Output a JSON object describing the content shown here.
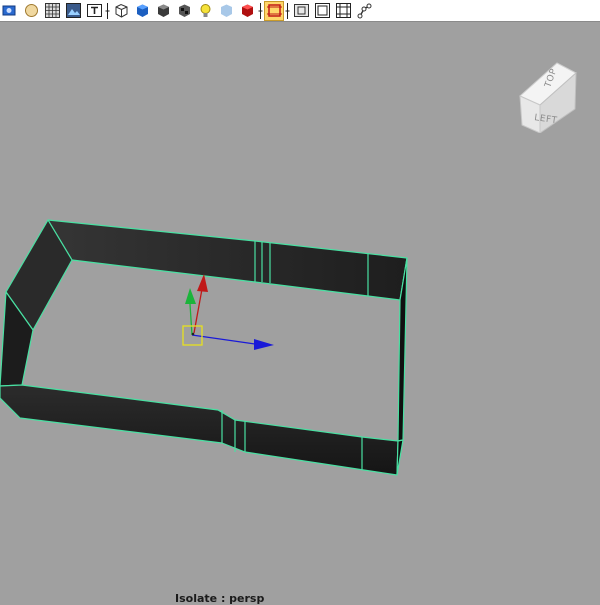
{
  "toolbar": {
    "items": [
      {
        "icon": "select-camera-icon"
      },
      {
        "icon": "camera-attributes-icon"
      },
      {
        "icon": "grid-icon"
      },
      {
        "icon": "image-plane-icon"
      },
      {
        "icon": "2d-pan-zoom-icon"
      },
      {
        "icon": "wireframe-icon"
      },
      {
        "icon": "smooth-shade-icon"
      },
      {
        "icon": "shade-object-icon"
      },
      {
        "icon": "textured-icon"
      },
      {
        "icon": "use-all-lights-icon"
      },
      {
        "icon": "shadows-icon"
      },
      {
        "icon": "render-icon"
      },
      {
        "icon": "xray-icon",
        "pressed": true
      },
      {
        "icon": "isolate-select-icon"
      },
      {
        "icon": "resolution-gate-icon"
      },
      {
        "icon": "film-gate-icon"
      },
      {
        "icon": "joint-icon"
      }
    ]
  },
  "viewcube": {
    "top_label": "TOP",
    "left_label": "LEFT"
  },
  "hud": {
    "isolate_label": "Isolate : persp"
  },
  "colors": {
    "viewport_bg": "#a0a0a0",
    "wire_highlight": "#49e0a2",
    "manip_x": "#1a1ad8",
    "manip_y": "#1bb43a",
    "manip_z": "#c01818",
    "manip_center": "#e8e020"
  }
}
